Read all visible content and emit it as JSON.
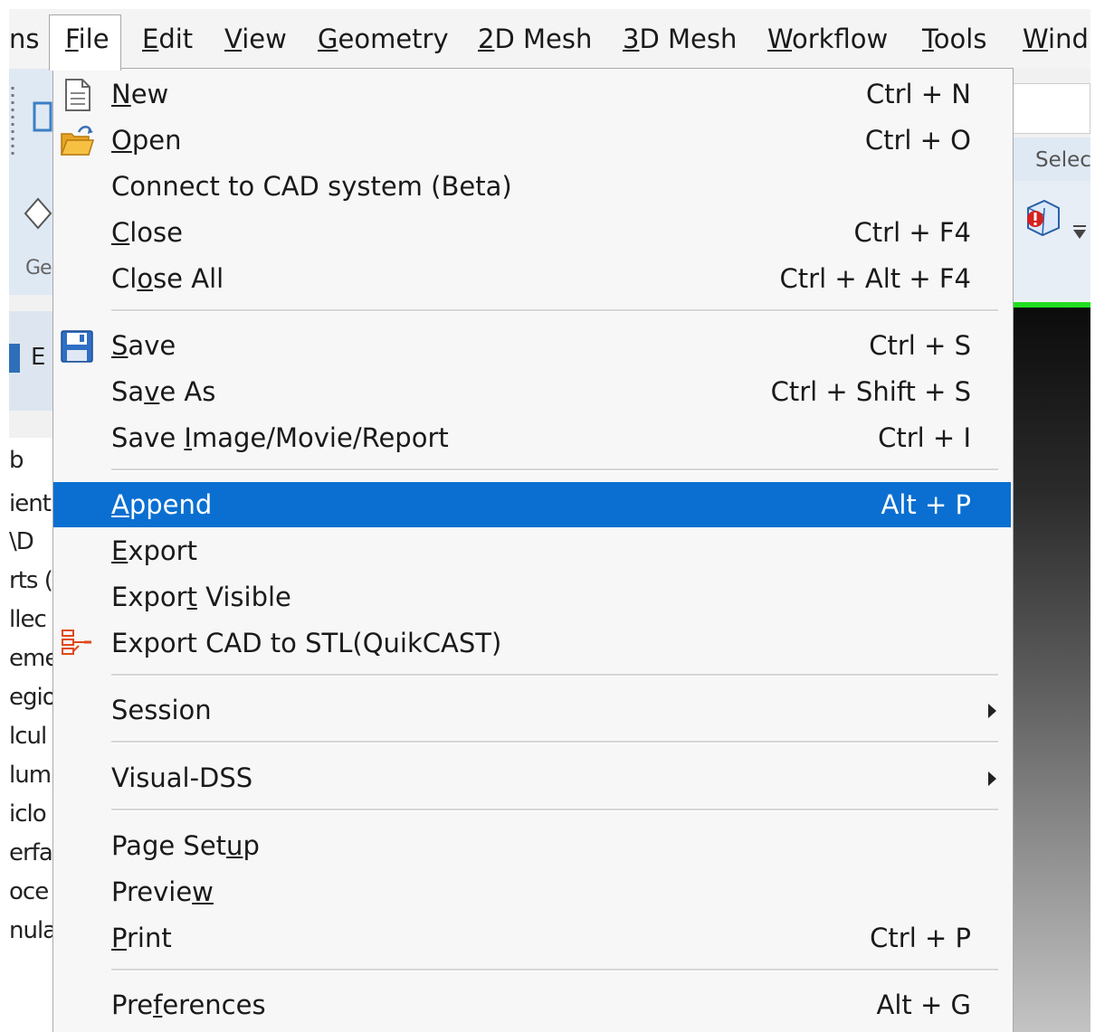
{
  "menubar": {
    "items": [
      {
        "pre": "",
        "u": "",
        "post": "ns"
      },
      {
        "pre": "",
        "u": "F",
        "post": "ile"
      },
      {
        "pre": "",
        "u": "E",
        "post": "dit"
      },
      {
        "pre": "",
        "u": "V",
        "post": "iew"
      },
      {
        "pre": "",
        "u": "G",
        "post": "eometry"
      },
      {
        "pre": "",
        "u": "2",
        "post": "D Mesh"
      },
      {
        "pre": "",
        "u": "3",
        "post": "D Mesh"
      },
      {
        "pre": "",
        "u": "W",
        "post": "orkflow"
      },
      {
        "pre": "",
        "u": "T",
        "post": "ools"
      },
      {
        "pre": "",
        "u": "W",
        "post": "ind"
      }
    ]
  },
  "file_menu": {
    "items": [
      {
        "pre": "",
        "u": "N",
        "post": "ew",
        "shortcut": "Ctrl + N",
        "icon": "new-file-icon"
      },
      {
        "pre": "",
        "u": "O",
        "post": "pen",
        "shortcut": "Ctrl + O",
        "icon": "open-folder-icon"
      },
      {
        "pre": "Connect to CAD system (Beta)",
        "u": "",
        "post": "",
        "shortcut": ""
      },
      {
        "pre": "",
        "u": "C",
        "post": "lose",
        "shortcut": "Ctrl + F4"
      },
      {
        "pre": "Cl",
        "u": "o",
        "post": "se All",
        "shortcut": "Ctrl + Alt + F4"
      },
      {
        "pre": "",
        "u": "S",
        "post": "ave",
        "shortcut": "Ctrl + S",
        "icon": "floppy-disk-icon"
      },
      {
        "pre": "Sa",
        "u": "v",
        "post": "e As",
        "shortcut": "Ctrl + Shift + S"
      },
      {
        "pre": "Save ",
        "u": "I",
        "post": "mage/Movie/Report",
        "shortcut": "Ctrl + I"
      },
      {
        "pre": "",
        "u": "A",
        "post": "ppend",
        "shortcut": "Alt + P",
        "highlighted": true
      },
      {
        "pre": "",
        "u": "E",
        "post": "xport",
        "shortcut": ""
      },
      {
        "pre": "Expor",
        "u": "t",
        "post": " Visible",
        "shortcut": ""
      },
      {
        "pre": "Export CAD to STL(QuikCAST)",
        "u": "",
        "post": "",
        "shortcut": "",
        "icon": "export-stl-icon"
      },
      {
        "pre": "Session",
        "u": "",
        "post": "",
        "shortcut": "",
        "submenu": true
      },
      {
        "pre": "Visual-DSS",
        "u": "",
        "post": "",
        "shortcut": "",
        "submenu": true
      },
      {
        "pre": "Page Set",
        "u": "u",
        "post": "p",
        "shortcut": ""
      },
      {
        "pre": "Previe",
        "u": "w",
        "post": "",
        "shortcut": ""
      },
      {
        "pre": "",
        "u": "P",
        "post": "rint",
        "shortcut": "Ctrl + P"
      },
      {
        "pre": "Pre",
        "u": "f",
        "post": "erences",
        "shortcut": "Alt + G"
      }
    ]
  },
  "background": {
    "left_ribbon_label": "Ge",
    "left_tab_label": "E",
    "left_tree": [
      "b",
      "ient",
      "\\D",
      "rts (",
      "llec",
      "eme",
      "egio",
      "lcul",
      "lum",
      "iclo",
      "erfa",
      "oce",
      "nula"
    ],
    "right_ribbon_label": "Selec"
  },
  "colors": {
    "highlight": "#0a6fd1",
    "viewport_accent": "#22dd22"
  }
}
